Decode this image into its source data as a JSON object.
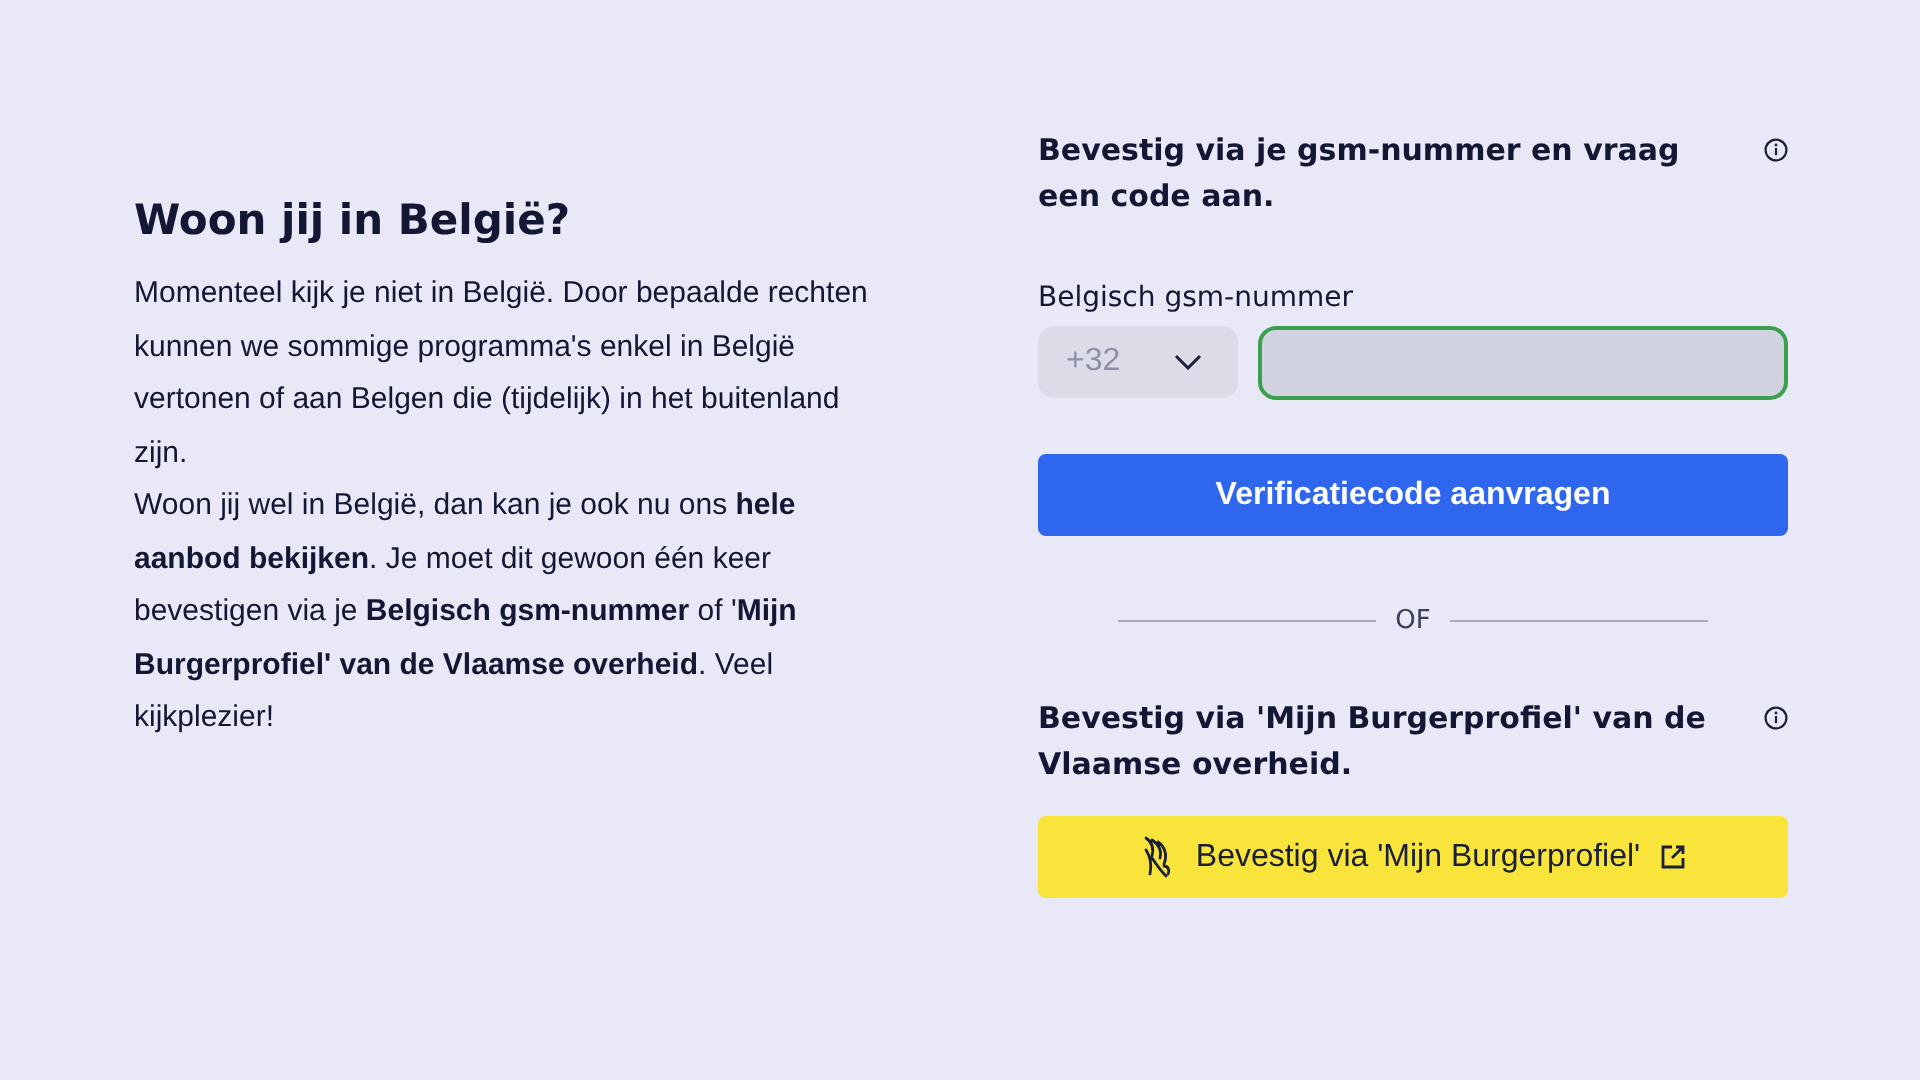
{
  "intro": {
    "title": "Woon jij in België?",
    "paragraphs": [
      "Momenteel kijk je niet in België. Door bepaalde rechten kunnen we sommige programma's enkel in België vertonen of aan Belgen die (tijdelijk) in het buitenland zijn.",
      "Woon jij wel in België, dan kan je ook nu ons **hele aanbod bekijken**. Je moet dit gewoon één keer bevestigen via je **Belgisch gsm-nummer** of '**Mijn Burgerprofiel' van de Vlaamse overheid**. Veel kijkplezier!"
    ]
  },
  "sms": {
    "title": "Bevestig via je gsm-nummer en vraag een code aan.",
    "label": "Belgisch gsm-nummer",
    "country_select": {
      "value": "+32",
      "disabled": true
    },
    "phone_field": {
      "focused": true
    },
    "button": "Verificatiecode aanvragen"
  },
  "divider": "OF",
  "profile": {
    "title": "Bevestig via 'Mijn Burgerprofiel' van de Vlaamse overheid.",
    "button": "Bevestig via 'Mijn Burgerprofiel'"
  }
}
